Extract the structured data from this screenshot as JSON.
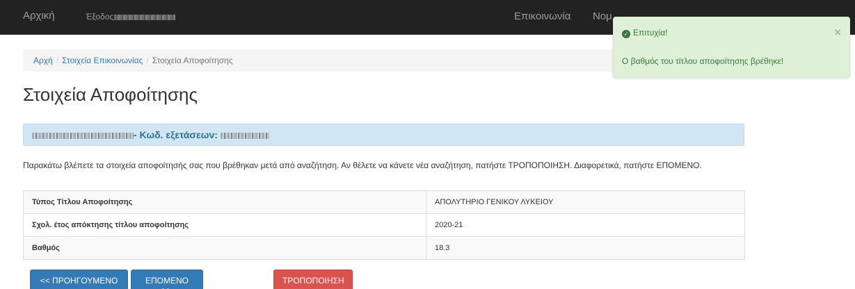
{
  "navbar": {
    "home": "Αρχική",
    "logout": "Έξοδος",
    "contact": "Επικοινωνία",
    "legal_partial": "Νομ"
  },
  "breadcrumb": {
    "items": [
      "Αρχή",
      "Στοιχεία Επικοινωνίας"
    ],
    "current": "Στοιχεία Αποφοίτησης",
    "separator": "/"
  },
  "page_title": "Στοιχεία Αποφοίτησης",
  "info_bar": {
    "exam_code_label": "- Κωδ. εξετάσεων:"
  },
  "description": "Παρακάτω βλέπετε τα στοιχεία αποφοίτησής σας που βρέθηκαν μετά από αναζήτηση. Αν θέλετε να κάνετε νέα αναζήτηση, πατήστε ΤΡΟΠΟΠΟΙΗΣΗ. Διαφορετικά, πατήστε ΕΠΟΜΕΝΟ.",
  "table": {
    "rows": [
      {
        "label": "Τύπος Τίτλου Αποφοίτησης",
        "value": "ΑΠΟΛΥΤΗΡΙΟ ΓΕΝΙΚΟΥ ΛΥΚΕΙΟΥ"
      },
      {
        "label": "Σχολ. έτος απόκτησης τίτλου αποφοίτησης",
        "value": "2020-21"
      },
      {
        "label": "Βαθμός",
        "value": "18.3"
      }
    ]
  },
  "buttons": {
    "prev": "<< ΠΡΟΗΓΟΥΜΕΝΟ",
    "next": "ΕΠΟΜΕΝΟ >>",
    "edit": "ΤΡΟΠΟΠΟΙΗΣΗ"
  },
  "toast": {
    "title": "Επιτυχία!",
    "message": "Ο βαθμός του τίτλου αποφοίτησης βρέθηκε!",
    "close": "×",
    "check_glyph": "✓"
  },
  "colors": {
    "navbar_bg": "#222222",
    "primary": "#337ab7",
    "danger": "#d9534f",
    "success_bg": "#dff0d8",
    "success_text": "#3c763d",
    "info_bg": "#d0e6f4"
  }
}
